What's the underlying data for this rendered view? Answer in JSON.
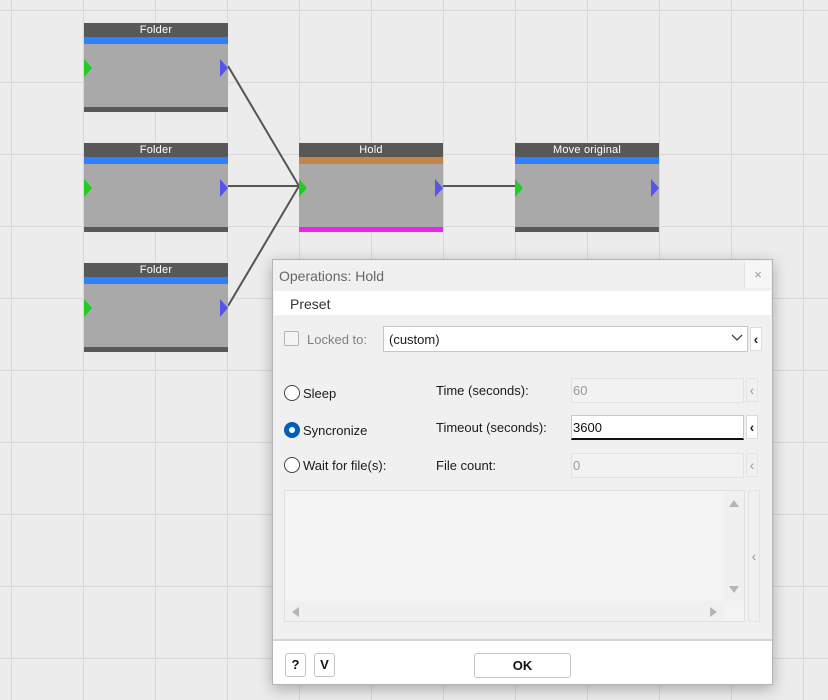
{
  "nodes": [
    {
      "title": "Folder",
      "accent": "#2f80ff",
      "bottom": "#595959"
    },
    {
      "title": "Folder",
      "accent": "#2f80ff",
      "bottom": "#595959"
    },
    {
      "title": "Folder",
      "accent": "#2f80ff",
      "bottom": "#595959"
    },
    {
      "title": "Hold",
      "accent": "#c5854a",
      "bottom": "#ee22ee"
    },
    {
      "title": "Move original",
      "accent": "#2f80ff",
      "bottom": "#595959"
    }
  ],
  "dialog": {
    "title": "Operations: Hold",
    "close_glyph": "×",
    "menu": {
      "preset": "Preset"
    },
    "locked": {
      "label": "Locked to:",
      "checked": false,
      "value": "(custom)"
    },
    "options": [
      {
        "label": "Sleep",
        "selected": false,
        "param_label": "Time (seconds):",
        "value": "60",
        "enabled": false
      },
      {
        "label": "Syncronize",
        "selected": true,
        "param_label": "Timeout (seconds):",
        "value": "3600",
        "enabled": true
      },
      {
        "label": "Wait for file(s):",
        "selected": false,
        "param_label": "File count:",
        "value": "0",
        "enabled": false
      }
    ],
    "footer": {
      "help_label": "?",
      "v_label": "V",
      "ok_label": "OK"
    }
  },
  "colors": {
    "input_port": "#22cc22",
    "output_port": "#5555ee",
    "selected_radio": "#005fb8"
  }
}
